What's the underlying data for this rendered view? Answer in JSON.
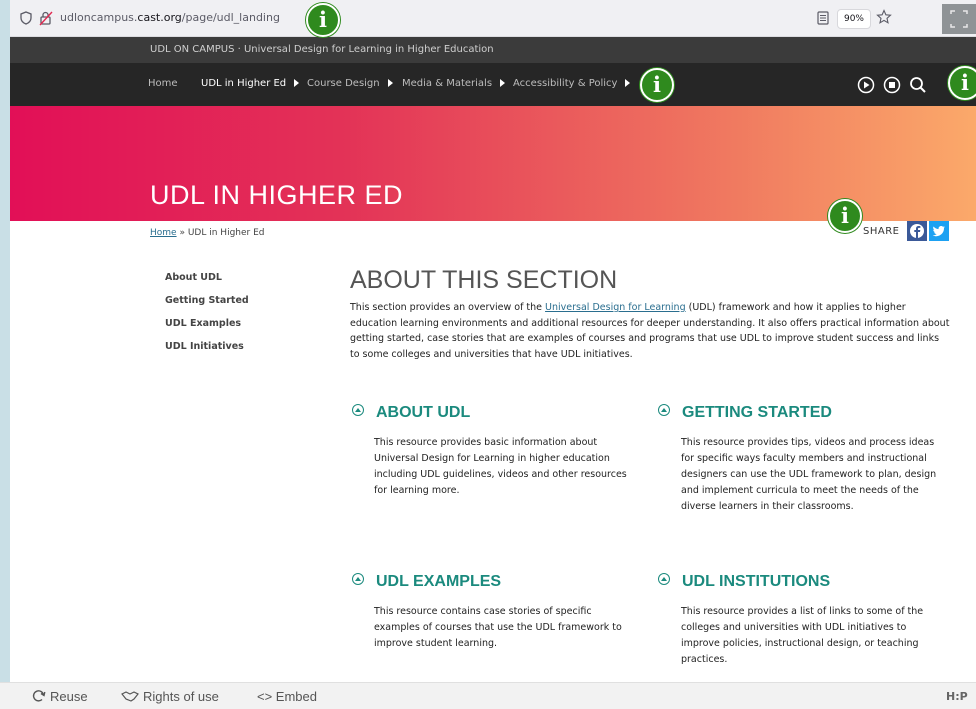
{
  "browser": {
    "url_prefix": "udloncampus.",
    "url_domain": "cast.org",
    "url_path": "/page/udl_landing",
    "zoom": "90%"
  },
  "site": {
    "tagline": "UDL ON CAMPUS · Universal Design for Learning in Higher Education"
  },
  "nav": {
    "items": [
      {
        "label": "Home"
      },
      {
        "label": "UDL in Higher Ed"
      },
      {
        "label": "Course Design"
      },
      {
        "label": "Media & Materials"
      },
      {
        "label": "Accessibility & Policy"
      }
    ]
  },
  "hero": {
    "title": "UDL IN HIGHER ED"
  },
  "breadcrumb": {
    "home": "Home",
    "separator": "»",
    "current": "UDL in Higher Ed"
  },
  "share_label": "SHARE",
  "sidebar": {
    "items": [
      "About UDL",
      "Getting Started",
      "UDL Examples",
      "UDL Initiatives"
    ]
  },
  "main": {
    "title": "ABOUT THIS SECTION",
    "intro_before": "This section provides an overview of the ",
    "intro_link": "Universal Design for Learning",
    "intro_after": " (UDL) framework and how it applies to higher education learning environments and additional resources for deeper understanding. It also offers practical information about getting started, case stories that are examples of courses and programs that use UDL to improve student success and links to some colleges and universities that have UDL initiatives.",
    "cards": [
      {
        "title": "ABOUT UDL",
        "text": "This resource provides basic information about Universal Design for Learning in higher education including UDL guidelines, videos and other resources for learning more."
      },
      {
        "title": "GETTING STARTED",
        "text": "This resource provides tips, videos and process ideas for specific ways faculty members and instructional designers can use the UDL framework to plan, design and implement curricula to meet the needs of the diverse learners in their classrooms."
      },
      {
        "title": "UDL EXAMPLES",
        "text": "This resource contains case stories of specific examples of courses that use the UDL framework to improve student learning."
      },
      {
        "title": "UDL INSTITUTIONS",
        "text": "This resource provides a list of links to some of the colleges and universities with UDL initiatives to improve policies, instructional design, or teaching practices."
      }
    ]
  },
  "hotspot_glyph": "i",
  "h5p": {
    "reuse": "Reuse",
    "rights": "Rights of use",
    "embed": "<> Embed",
    "logo": "H:P"
  },
  "colors": {
    "accent": "#1b8a7e",
    "hero_start": "#e20f57",
    "hero_end": "#fba96a",
    "hotspot": "#2f8a1e"
  }
}
